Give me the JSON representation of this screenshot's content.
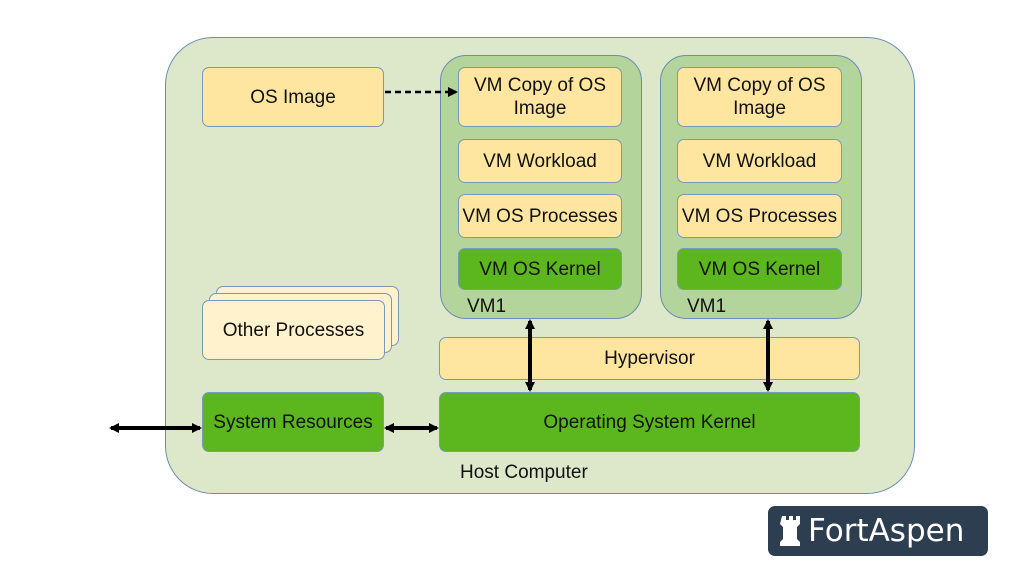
{
  "host": {
    "label": "Host Computer"
  },
  "os_image": "OS Image",
  "vms": [
    {
      "label": "VM1",
      "copy": "VM Copy of OS Image",
      "workload": "VM Workload",
      "processes": "VM OS Processes",
      "kernel": "VM OS Kernel"
    },
    {
      "label": "VM1",
      "copy": "VM Copy of OS Image",
      "workload": "VM Workload",
      "processes": "VM OS Processes",
      "kernel": "VM OS Kernel"
    }
  ],
  "other_processes": "Other Processes",
  "hypervisor": "Hypervisor",
  "system_resources": "System Resources",
  "os_kernel": "Operating System Kernel",
  "logo": {
    "text": "FortAspen",
    "icon": "rook-icon"
  },
  "colors": {
    "host": "#dde8cb",
    "vm": "#b3d49a",
    "yellow": "#ffe6a0",
    "green": "#5cb71f",
    "logo": "#2c3e50"
  }
}
